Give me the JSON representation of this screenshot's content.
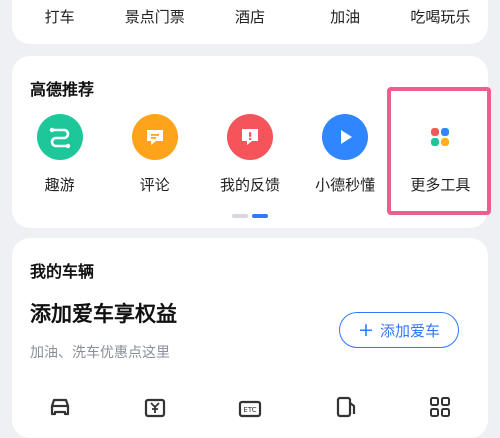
{
  "top_row": [
    "打车",
    "景点门票",
    "酒店",
    "加油",
    "吃喝玩乐"
  ],
  "recommend": {
    "title": "高德推荐",
    "tools": [
      {
        "label": "趣游",
        "icon": "route-icon",
        "color": "#1ec79a"
      },
      {
        "label": "评论",
        "icon": "comment-icon",
        "color": "#ffa31a"
      },
      {
        "label": "我的反馈",
        "icon": "feedback-icon",
        "color": "#f4545a"
      },
      {
        "label": "小德秒懂",
        "icon": "play-icon",
        "color": "#2f86ff"
      },
      {
        "label": "更多工具",
        "icon": "grid-icon",
        "color": "#ffffff"
      }
    ]
  },
  "car": {
    "title": "我的车辆",
    "headline": "添加爱车享权益",
    "subtitle": "加油、洗车优惠点这里",
    "add_button": "添加爱车",
    "icons": [
      "car-icon",
      "yen-icon",
      "etc-icon",
      "fuel-icon",
      "grid-icon"
    ]
  },
  "colors": {
    "accent": "#2f78ff",
    "highlight": "#ec5d90"
  }
}
